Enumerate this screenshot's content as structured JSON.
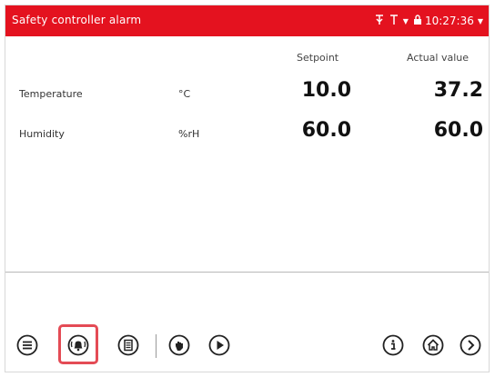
{
  "header": {
    "title": "Safety controller alarm",
    "time": "10:27:36",
    "bg_color": "#e4121f"
  },
  "table": {
    "columns": [
      "Setpoint",
      "Actual value"
    ],
    "rows": [
      {
        "name": "Temperature",
        "unit": "°C",
        "setpoint": "10.0",
        "actual": "37.2"
      },
      {
        "name": "Humidity",
        "unit": "%rH",
        "setpoint": "60.0",
        "actual": "60.0"
      }
    ]
  },
  "toolbar": {
    "buttons": [
      {
        "name": "list-menu",
        "icon": "menu-list-icon"
      },
      {
        "name": "alarm",
        "icon": "bell-icon",
        "highlighted": true
      },
      {
        "name": "event-list",
        "icon": "document-list-icon"
      },
      {
        "name": "manual-mode",
        "icon": "hand-icon"
      },
      {
        "name": "program-start",
        "icon": "play-icon"
      },
      {
        "name": "info",
        "icon": "info-icon"
      },
      {
        "name": "home",
        "icon": "home-icon"
      },
      {
        "name": "next",
        "icon": "chevron-right-icon"
      }
    ],
    "highlight_color": "#e44b55"
  }
}
